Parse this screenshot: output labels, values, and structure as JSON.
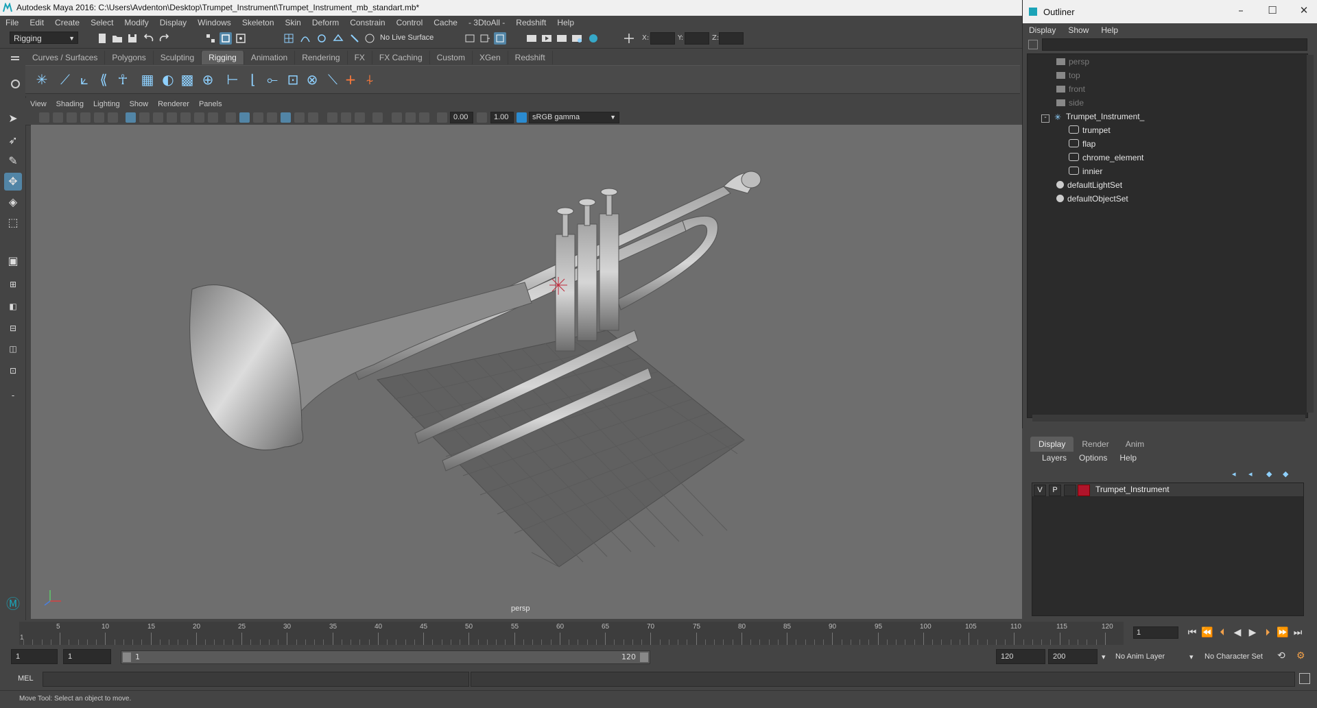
{
  "app": {
    "title": "Autodesk Maya 2016: C:\\Users\\Avdenton\\Desktop\\Trumpet_Instrument\\Trumpet_Instrument_mb_standart.mb*"
  },
  "menubar": [
    "File",
    "Edit",
    "Create",
    "Select",
    "Modify",
    "Display",
    "Windows",
    "Skeleton",
    "Skin",
    "Deform",
    "Constrain",
    "Control",
    "Cache",
    "- 3DtoAll -",
    "Redshift",
    "Help"
  ],
  "statusline": {
    "mode": "Rigging",
    "live_surface": "No Live Surface",
    "x_label": "X:",
    "y_label": "Y:",
    "z_label": "Z:"
  },
  "shelf": {
    "tabs": [
      "Curves / Surfaces",
      "Polygons",
      "Sculpting",
      "Rigging",
      "Animation",
      "Rendering",
      "FX",
      "FX Caching",
      "Custom",
      "XGen",
      "Redshift"
    ],
    "active_tab": "Rigging"
  },
  "viewport": {
    "menu": [
      "View",
      "Shading",
      "Lighting",
      "Show",
      "Renderer",
      "Panels"
    ],
    "exposure": "0.00",
    "gamma": "1.00",
    "color_space": "sRGB gamma",
    "camera": "persp"
  },
  "outliner": {
    "title": "Outliner",
    "menu": [
      "Display",
      "Show",
      "Help"
    ],
    "items": [
      {
        "label": "persp",
        "dim": true,
        "icon": "camera-icon"
      },
      {
        "label": "top",
        "dim": true,
        "icon": "camera-icon"
      },
      {
        "label": "front",
        "dim": true,
        "icon": "camera-icon"
      },
      {
        "label": "side",
        "dim": true,
        "icon": "camera-icon"
      },
      {
        "label": "Trumpet_Instrument_",
        "dim": false,
        "icon": "joint-icon"
      },
      {
        "label": "trumpet",
        "dim": false,
        "icon": "mesh-icon"
      },
      {
        "label": "flap",
        "dim": false,
        "icon": "mesh-icon"
      },
      {
        "label": "chrome_element",
        "dim": false,
        "icon": "mesh-icon"
      },
      {
        "label": "innier",
        "dim": false,
        "icon": "mesh-icon"
      },
      {
        "label": "defaultLightSet",
        "dim": false,
        "icon": "set-icon"
      },
      {
        "label": "defaultObjectSet",
        "dim": false,
        "icon": "set-icon"
      }
    ]
  },
  "layer_panel": {
    "tabs": [
      "Display",
      "Render",
      "Anim"
    ],
    "menu": [
      "Layers",
      "Options",
      "Help"
    ],
    "layer": {
      "v": "V",
      "p": "P",
      "name": "Trumpet_Instrument",
      "color": "#b0142a"
    }
  },
  "timeline": {
    "ticks": [
      "1",
      "5",
      "10",
      "15",
      "20",
      "25",
      "30",
      "35",
      "40",
      "45",
      "50",
      "55",
      "60",
      "65",
      "70",
      "75",
      "80",
      "85",
      "90",
      "95",
      "100",
      "105",
      "110",
      "115",
      "120"
    ],
    "current_frame": "1"
  },
  "range": {
    "start": "1",
    "playback_start": "1",
    "slider_start": "1",
    "slider_end": "120",
    "playback_end": "120",
    "end": "200",
    "anim_layer": "No Anim Layer",
    "char_set": "No Character Set"
  },
  "cmdline": {
    "label": "MEL"
  },
  "helpline": {
    "text": "Move Tool: Select an object to move."
  },
  "colors": {
    "accent": "#5285a6",
    "layer": "#b0142a",
    "icon_blue": "#8fd1ff"
  }
}
